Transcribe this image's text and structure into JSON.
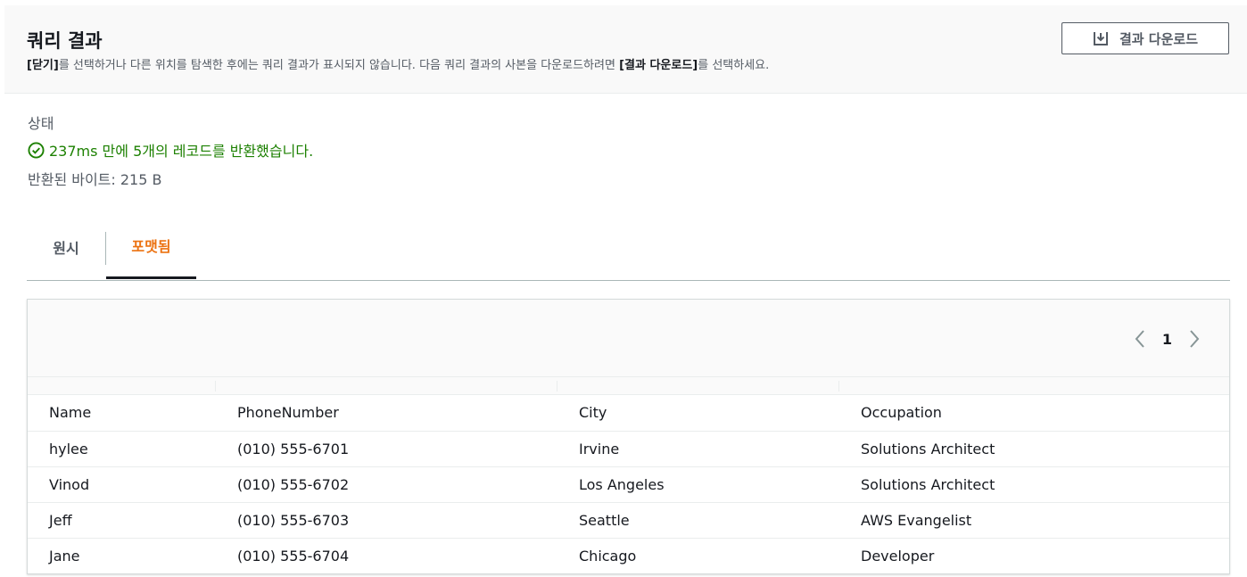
{
  "header": {
    "title": "쿼리 결과",
    "desc_part1": "[닫기]",
    "desc_part2": "를 선택하거나 다른 위치를 탐색한 후에는 쿼리 결과가 표시되지 않습니다. 다음 쿼리 결과의 사본을 다운로드하려면 ",
    "desc_part3": "[결과 다운로드]",
    "desc_part4": "를 선택하세요.",
    "download_label": "결과 다운로드"
  },
  "status": {
    "label": "상태",
    "message": "237ms 만에 5개의 레코드를 반환했습니다.",
    "bytes": "반환된 바이트: 215 B"
  },
  "tabs": [
    {
      "label": "원시",
      "active": false
    },
    {
      "label": "포맷됨",
      "active": true
    }
  ],
  "pager": {
    "current": "1"
  },
  "table": {
    "rows": [
      [
        "Name",
        "PhoneNumber",
        "City",
        "Occupation"
      ],
      [
        "hylee",
        "(010) 555-6701",
        "Irvine",
        "Solutions Architect"
      ],
      [
        "Vinod",
        "(010) 555-6702",
        "Los Angeles",
        "Solutions Architect"
      ],
      [
        "Jeff",
        "(010) 555-6703",
        "Seattle",
        "AWS Evangelist"
      ],
      [
        "Jane",
        "(010) 555-6704",
        "Chicago",
        "Developer"
      ]
    ]
  },
  "colors": {
    "accent": "#ec7211",
    "success": "#1d8102",
    "text": "#16191f",
    "secondary": "#545b64"
  },
  "icons": {
    "download": "download-icon",
    "success": "check-circle-icon",
    "prev": "chevron-left-icon",
    "next": "chevron-right-icon"
  }
}
